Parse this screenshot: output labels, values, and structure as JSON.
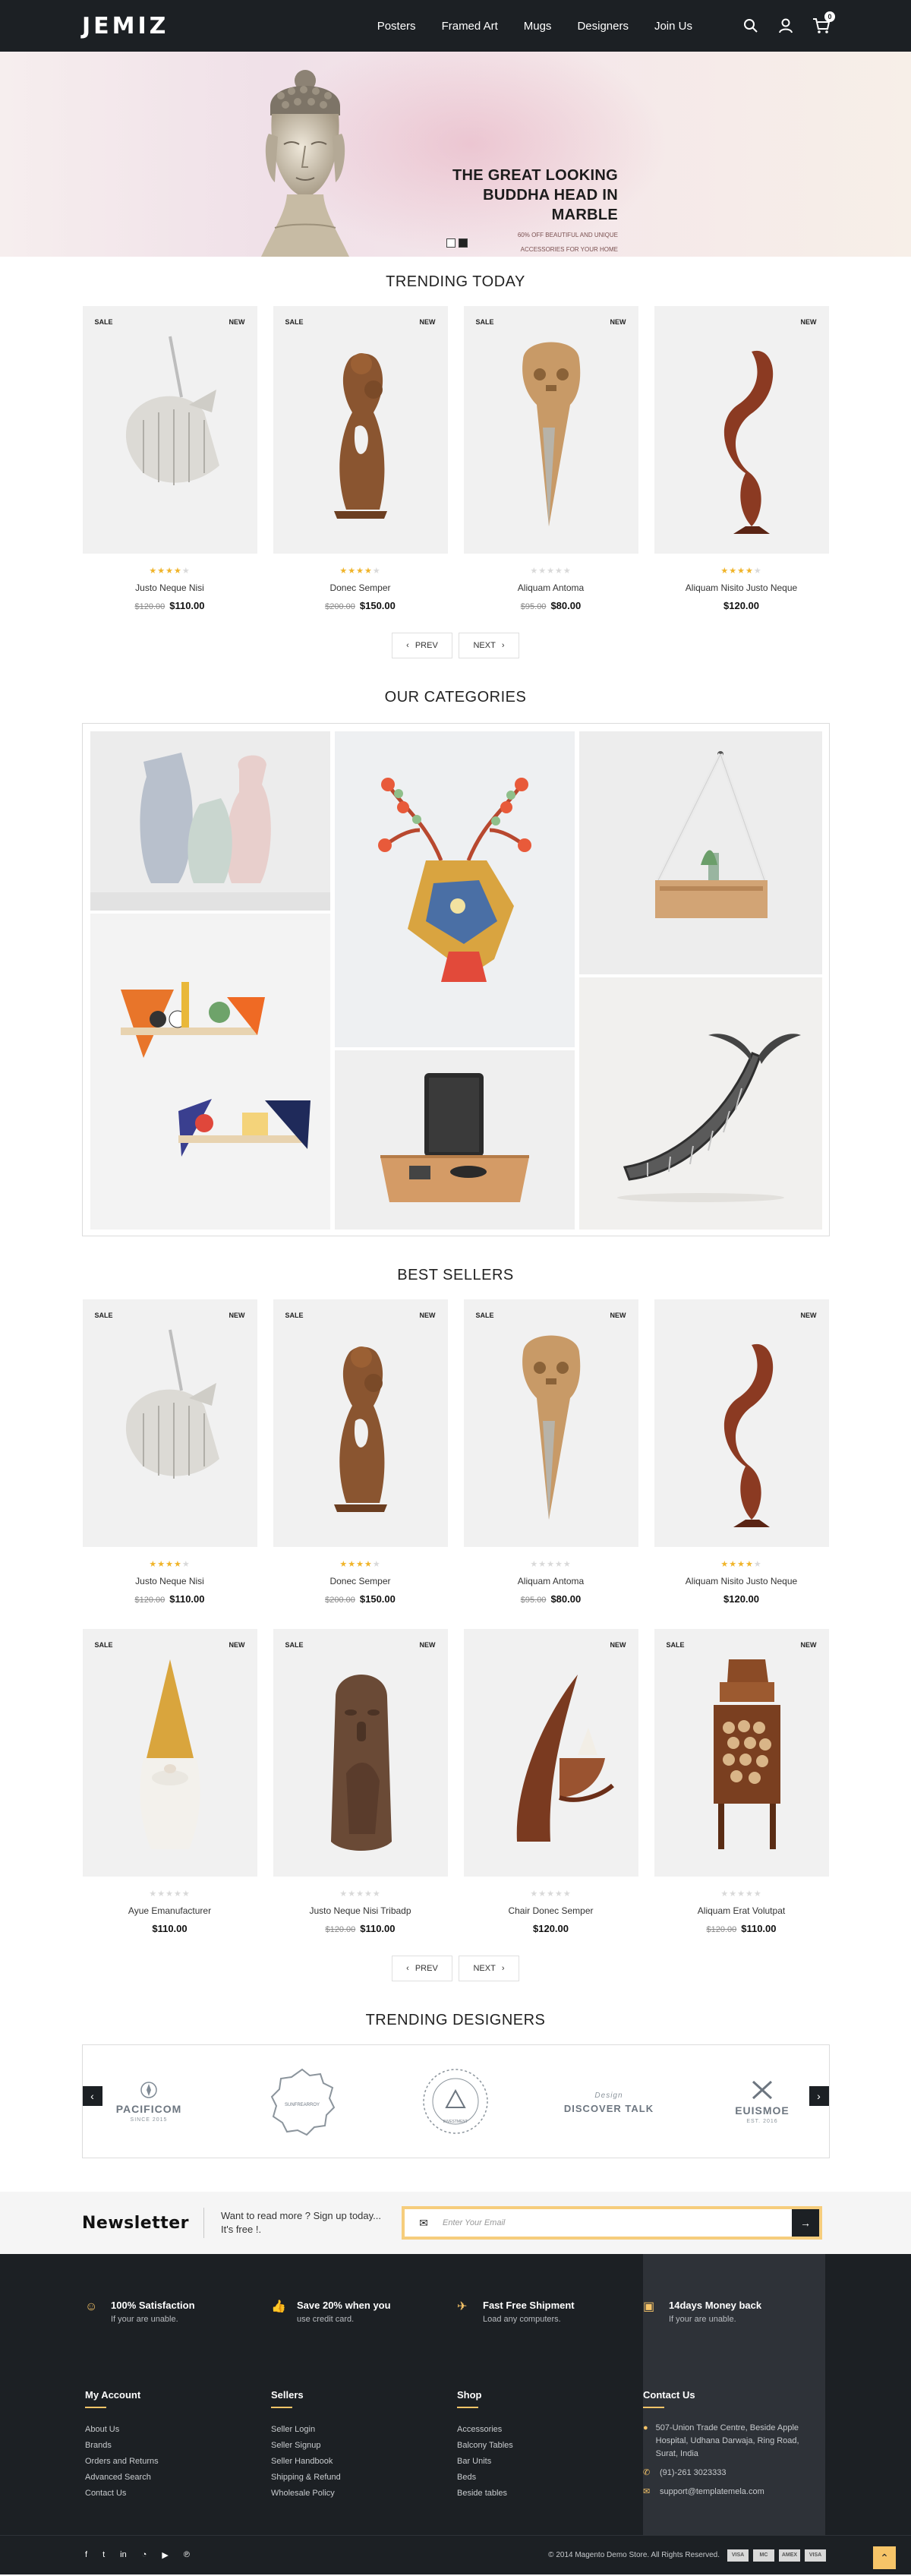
{
  "header": {
    "logo": "JEMIZ",
    "nav": [
      "Posters",
      "Framed Art",
      "Mugs",
      "Designers",
      "Join Us"
    ],
    "cart_count": "0"
  },
  "hero": {
    "title_line1": "THE GREAT LOOKING",
    "title_line2": "BUDDHA HEAD IN MARBLE",
    "sub_line1": "60% OFF BEAUTIFUL AND UNIQUE",
    "sub_line2": "ACCESSORIES FOR YOUR HOME"
  },
  "trending": {
    "title": "TRENDING TODAY",
    "products": [
      {
        "name": "Justo Neque Nisi",
        "old": "$120.00",
        "price": "$110.00",
        "sale": "SALE",
        "new": "NEW",
        "rating": 4
      },
      {
        "name": "Donec Semper",
        "old": "$200.00",
        "price": "$150.00",
        "sale": "SALE",
        "new": "NEW",
        "rating": 4
      },
      {
        "name": "Aliquam Antoma",
        "old": "$95.00",
        "price": "$80.00",
        "sale": "SALE",
        "new": "NEW",
        "rating": 0
      },
      {
        "name": "Aliquam Nisito Justo Neque",
        "old": "",
        "price": "$120.00",
        "sale": "",
        "new": "NEW",
        "rating": 4
      }
    ]
  },
  "pager": {
    "prev": "PREV",
    "next": "NEXT"
  },
  "categories": {
    "title": "OUR CATEGORIES"
  },
  "bestsellers": {
    "title": "BEST SELLERS",
    "products": [
      {
        "name": "Justo Neque Nisi",
        "old": "$120.00",
        "price": "$110.00",
        "sale": "SALE",
        "new": "NEW",
        "rating": 4
      },
      {
        "name": "Donec Semper",
        "old": "$200.00",
        "price": "$150.00",
        "sale": "SALE",
        "new": "NEW",
        "rating": 4
      },
      {
        "name": "Aliquam Antoma",
        "old": "$95.00",
        "price": "$80.00",
        "sale": "SALE",
        "new": "NEW",
        "rating": 0
      },
      {
        "name": "Aliquam Nisito Justo Neque",
        "old": "",
        "price": "$120.00",
        "sale": "",
        "new": "NEW",
        "rating": 4
      },
      {
        "name": "Ayue Emanufacturer",
        "old": "",
        "price": "$110.00",
        "sale": "SALE",
        "new": "NEW",
        "rating": 0
      },
      {
        "name": "Justo Neque Nisi Tribadp",
        "old": "$120.00",
        "price": "$110.00",
        "sale": "SALE",
        "new": "NEW",
        "rating": 0
      },
      {
        "name": "Chair Donec Semper",
        "old": "",
        "price": "$120.00",
        "sale": "",
        "new": "NEW",
        "rating": 0
      },
      {
        "name": "Aliquam Erat Volutpat",
        "old": "$120.00",
        "price": "$110.00",
        "sale": "SALE",
        "new": "NEW",
        "rating": 0
      }
    ]
  },
  "designers": {
    "title": "TRENDING DESIGNERS",
    "brands": [
      {
        "name": "PACIFICOM",
        "sub": "SINCE 2015"
      },
      {
        "name": "SUNFREARROY",
        "sub": ""
      },
      {
        "name": "INVESTMENT",
        "sub": ""
      },
      {
        "name": "DISCOVER TALK",
        "sub": "Design"
      },
      {
        "name": "EUISMOE",
        "sub": "EST. 2016"
      }
    ]
  },
  "newsletter": {
    "title": "Newsletter",
    "text_line1": "Want to read more ? Sign up today...",
    "text_line2": "It's free !.",
    "placeholder": "Enter Your Email"
  },
  "features": [
    {
      "title": "100% Satisfaction",
      "desc": "If your are unable.",
      "icon": "smile-icon"
    },
    {
      "title": "Save 20% when you",
      "desc": "use credit card.",
      "icon": "thumbs-up-icon"
    },
    {
      "title": "Fast Free Shipment",
      "desc": "Load any computers.",
      "icon": "plane-icon"
    },
    {
      "title": "14days Money back",
      "desc": "If your are unable.",
      "icon": "money-icon"
    }
  ],
  "footer": {
    "my_account": {
      "title": "My Account",
      "links": [
        "About Us",
        "Brands",
        "Orders and Returns",
        "Advanced Search",
        "Contact Us"
      ]
    },
    "sellers": {
      "title": "Sellers",
      "links": [
        "Seller Login",
        "Seller Signup",
        "Seller Handbook",
        "Shipping & Refund",
        "Wholesale Policy"
      ]
    },
    "shop": {
      "title": "Shop",
      "links": [
        "Accessories",
        "Balcony Tables",
        "Bar Units",
        "Beds",
        "Beside tables"
      ]
    },
    "contact": {
      "title": "Contact Us",
      "address": "507-Union Trade Centre, Beside Apple Hospital, Udhana Darwaja, Ring Road, Surat, India",
      "phone": "(91)-261 3023333",
      "email": "support@templatemela.com"
    },
    "copyright": "© 2014 Magento Demo Store. All Rights Reserved.",
    "payments": [
      "VISA",
      "MC",
      "AMEX",
      "VISA"
    ]
  },
  "colors": {
    "dark": "#1c2024",
    "accent": "#f6c468",
    "star": "#f0b429"
  }
}
